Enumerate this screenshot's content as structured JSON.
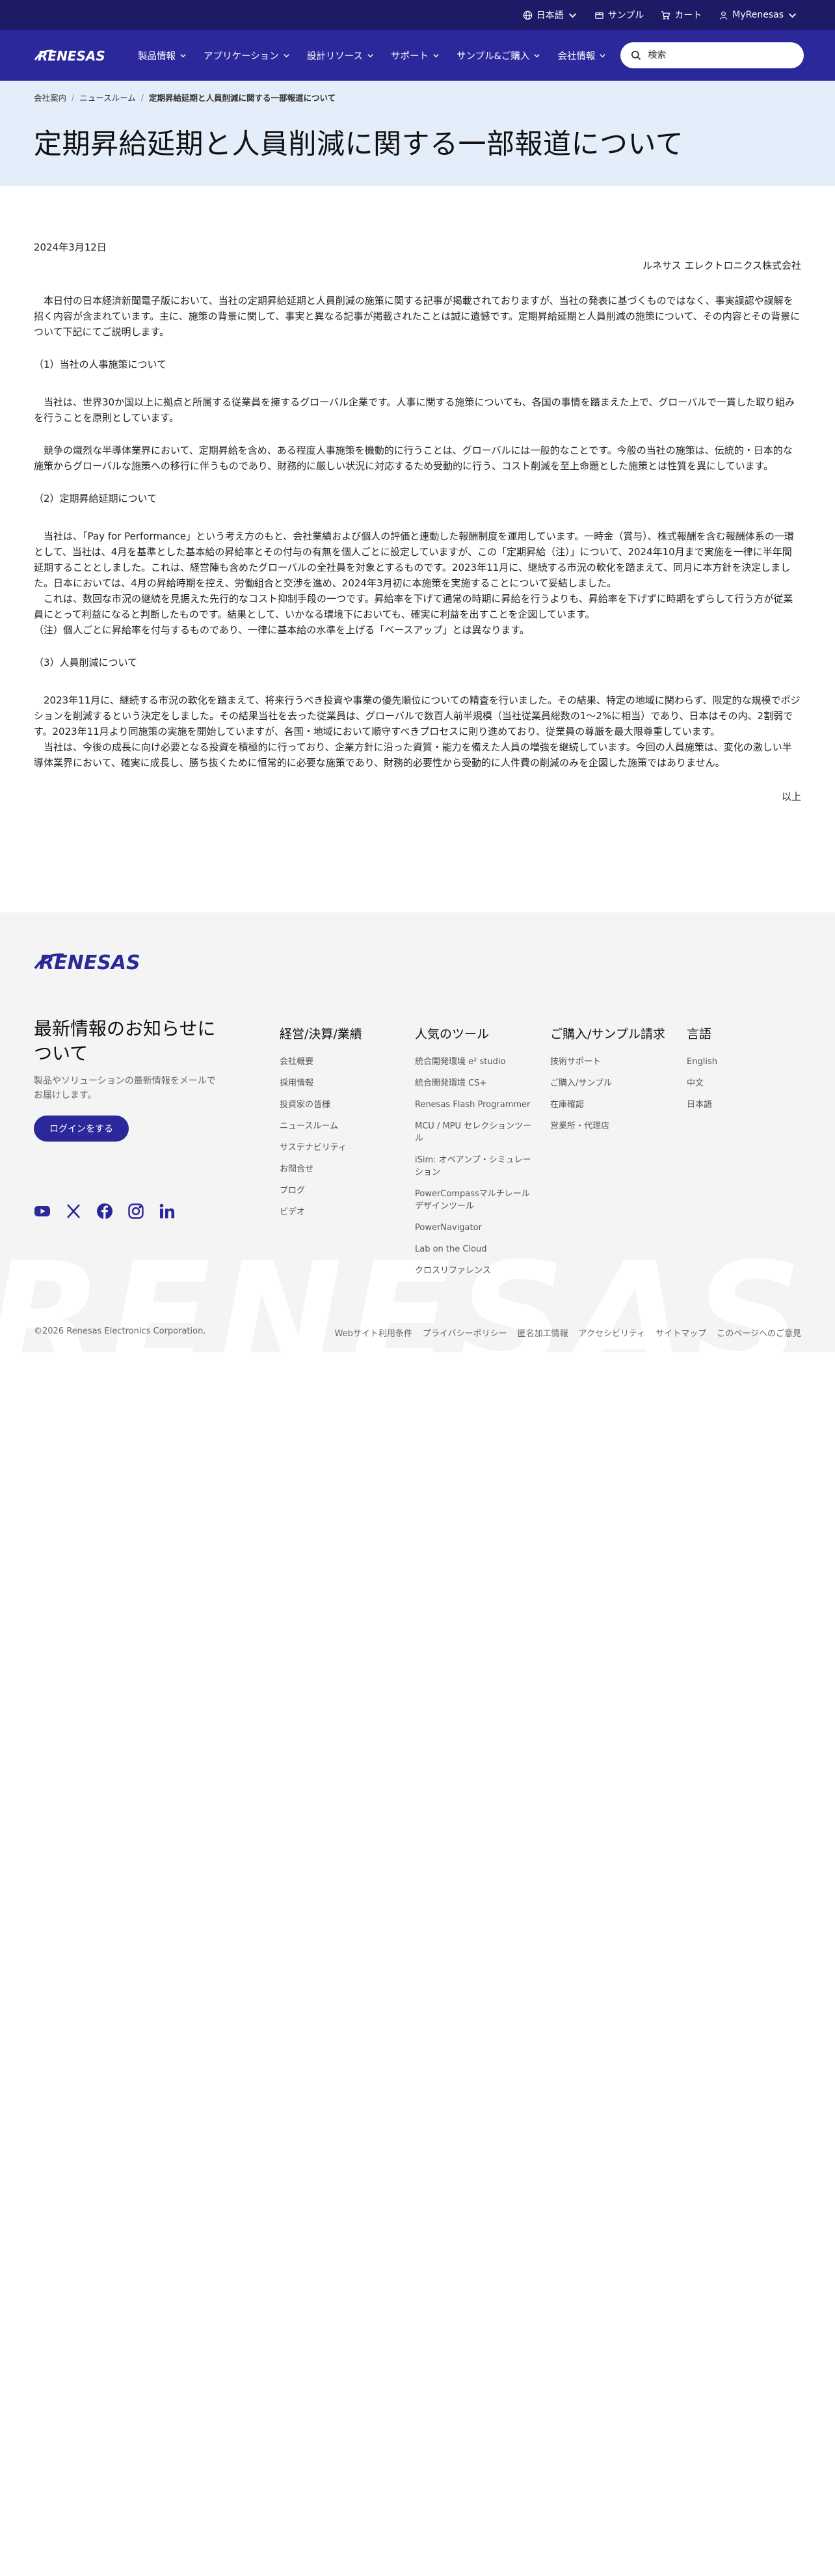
{
  "util_bar": {
    "language": "日本語",
    "sample": "サンプル",
    "cart": "カート",
    "account": "MyRenesas"
  },
  "nav": {
    "logo": "RENESAS",
    "items": [
      {
        "label": "製品情報"
      },
      {
        "label": "アプリケーション"
      },
      {
        "label": "設計リソース"
      },
      {
        "label": "サポート"
      },
      {
        "label": "サンプル&ご購入"
      },
      {
        "label": "会社情報"
      }
    ],
    "search_placeholder": "検索"
  },
  "breadcrumb": [
    "会社案内",
    "ニュースルーム",
    "定期昇給延期と人員削減に関する一部報道について"
  ],
  "page_title": "定期昇給延期と人員削減に関する一部報道について",
  "article": {
    "date": "2024年3月12日",
    "company": "ルネサス エレクトロニクス株式会社",
    "intro": "　本日付の日本経済新聞電子版において、当社の定期昇給延期と人員削減の施策に関する記事が掲載されておりますが、当社の発表に基づくものではなく、事実誤認や誤解を招く内容が含まれています。主に、施策の背景に関して、事実と異なる記事が掲載されたことは誠に遺憾です。定期昇給延期と人員削減の施策について、その内容とその背景について下記にてご説明します。",
    "section1_title": "（1）当社の人事施策について",
    "section1_p1": "　当社は、世界30か国以上に拠点と所属する従業員を擁するグローバル企業です。人事に関する施策についても、各国の事情を踏まえた上で、グローバルで一貫した取り組みを行うことを原則としています。",
    "section1_p2": "　競争の熾烈な半導体業界において、定期昇給を含め、ある程度人事施策を機動的に行うことは、グローバルには一般的なことです。今般の当社の施策は、伝統的・日本的な施策からグローバルな施策への移行に伴うものであり、財務的に厳しい状況に対応するため受動的に行う、コスト削減を至上命題とした施策とは性質を異にしています。",
    "section2_title": "（2）定期昇給延期について",
    "section2_p1": "　当社は、「Pay for Performance」という考え方のもと、会社業績および個人の評価と連動した報酬制度を運用しています。一時金（賞与）、株式報酬を含む報酬体系の一環として、当社は、4月を基準とした基本給の昇給率とその付与の有無を個人ごとに設定していますが、この「定期昇給（注）」について、2024年10月まで実施を一律に半年間延期することとしました。これは、経営陣も含めたグローバルの全社員を対象とするものです。2023年11月に、継続する市況の軟化を踏まえて、同月に本方針を決定しました。日本においては、4月の昇給時期を控え、労働組合と交渉を進め、2024年3月初に本施策を実施することについて妥結しました。",
    "section2_p2": "　これは、数回な市況の継続を見据えた先行的なコスト抑制手段の一つです。昇給率を下げて通常の時期に昇給を行うよりも、昇給率を下げずに時期をずらして行う方が従業員にとって利益になると判断したものです。結果として、いかなる環境下においても、確実に利益を出すことを企図しています。",
    "section2_note": "（注）個人ごとに昇給率を付与するものであり、一律に基本給の水準を上げる「ベースアップ」とは異なります。",
    "section3_title": "（3）人員削減について",
    "section3_p1": "　2023年11月に、継続する市況の軟化を踏まえて、将来行うべき投資や事業の優先順位についての精査を行いました。その結果、特定の地域に関わらず、限定的な規模でポジションを削減するという決定をしました。その結果当社を去った従業員は、グローバルで数百人前半規模（当社従業員総数の1〜2%に相当）であり、日本はその内、2割弱です。2023年11月より同施策の実施を開始していますが、各国・地域において順守すべきプロセスに則り進めており、従業員の尊厳を最大限尊重しています。",
    "section3_p2": "　当社は、今後の成長に向け必要となる投資を積極的に行っており、企業方針に沿った資質・能力を備えた人員の増強を継続しています。今回の人員施策は、変化の激しい半導体業界において、確実に成長し、勝ち抜くために恒常的に必要な施策であり、財務的必要性から受動的に人件費の削減のみを企図した施策ではありません。",
    "closing": "以上"
  },
  "footer": {
    "logo": "RENESAS",
    "watermark": "RENESAS",
    "news_title": "最新情報のお知らせについて",
    "news_desc": "製品やソリューションの最新情報をメールでお届けします。",
    "login_label": "ログインをする",
    "social_icons": [
      "youtube-icon",
      "x-icon",
      "facebook-icon",
      "instagram-icon",
      "linkedin-icon"
    ],
    "columns": [
      {
        "title": "経営/決算/業績",
        "links": [
          "会社概要",
          "採用情報",
          "投資家の皆様",
          "ニュースルーム",
          "サステナビリティ",
          "お問合せ",
          "ブログ",
          "ビデオ"
        ]
      },
      {
        "title": "人気のツール",
        "links": [
          "統合開発環境 e² studio",
          "統合開発環境 CS+",
          "Renesas Flash Programmer",
          "MCU / MPU セレクションツール",
          "iSim: オペアンプ・シミュレーション",
          "PowerCompassマルチレールデザインツール",
          "PowerNavigator",
          "Lab on the Cloud",
          "クロスリファレンス"
        ]
      },
      {
        "title": "ご購入/サンプル請求",
        "links": [
          "技術サポート",
          "ご購入/サンプル",
          "在庫確認",
          "営業所・代理店"
        ]
      },
      {
        "title": "言語",
        "links": [
          "English",
          "中文",
          "日本語"
        ]
      }
    ],
    "copyright": "©2026 Renesas Electronics Corporation.",
    "legal_links": [
      "Webサイト利用条件",
      "プライバシーポリシー",
      "匿名加工情報",
      "アクセシビリティ",
      "サイトマップ",
      "このページへのご意見"
    ]
  }
}
